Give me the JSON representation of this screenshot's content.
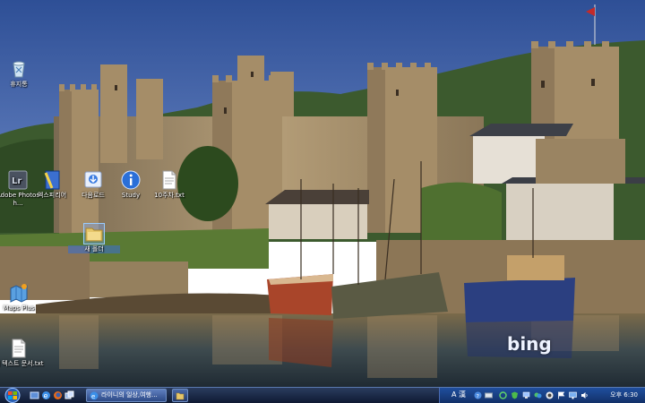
{
  "desktop": {
    "icons": [
      {
        "label": "휴지통",
        "icon": "recycle-bin-icon"
      },
      {
        "label": "Adobe Photosh...",
        "icon": "lightroom-app-icon"
      },
      {
        "label": "엑스피리어",
        "icon": "application-icon"
      },
      {
        "label": "다음로드",
        "icon": "download-manager-icon"
      },
      {
        "label": "Study",
        "icon": "info-folder-icon"
      },
      {
        "label": "10주차.txt",
        "icon": "text-file-icon"
      },
      {
        "label": "새 폴더",
        "icon": "folder-icon"
      },
      {
        "label": "Maps Plus",
        "icon": "maps-app-icon"
      },
      {
        "label": "새 텍스트 문서.txt",
        "icon": "text-file-icon"
      }
    ],
    "watermark": "bing"
  },
  "taskbar": {
    "start_icon": "windows-start-orb-icon",
    "quick_launch": [
      "show-desktop-icon",
      "internet-explorer-icon",
      "firefox-icon",
      "window-switch-icon"
    ],
    "tasks": [
      {
        "label": "라이니의 일상,여행...",
        "icon": "internet-explorer-icon",
        "active": true
      },
      {
        "label": "",
        "icon": "folder-icon",
        "active": false
      }
    ],
    "tray": {
      "ime": "A 漢",
      "icons": [
        "help-icon",
        "keyboard-icon",
        "refresh-icon",
        "shield-icon",
        "network-icon",
        "messenger-icon",
        "update-icon",
        "flag-icon",
        "monitor-icon",
        "volume-icon"
      ],
      "clock": "오후 6:30"
    }
  }
}
